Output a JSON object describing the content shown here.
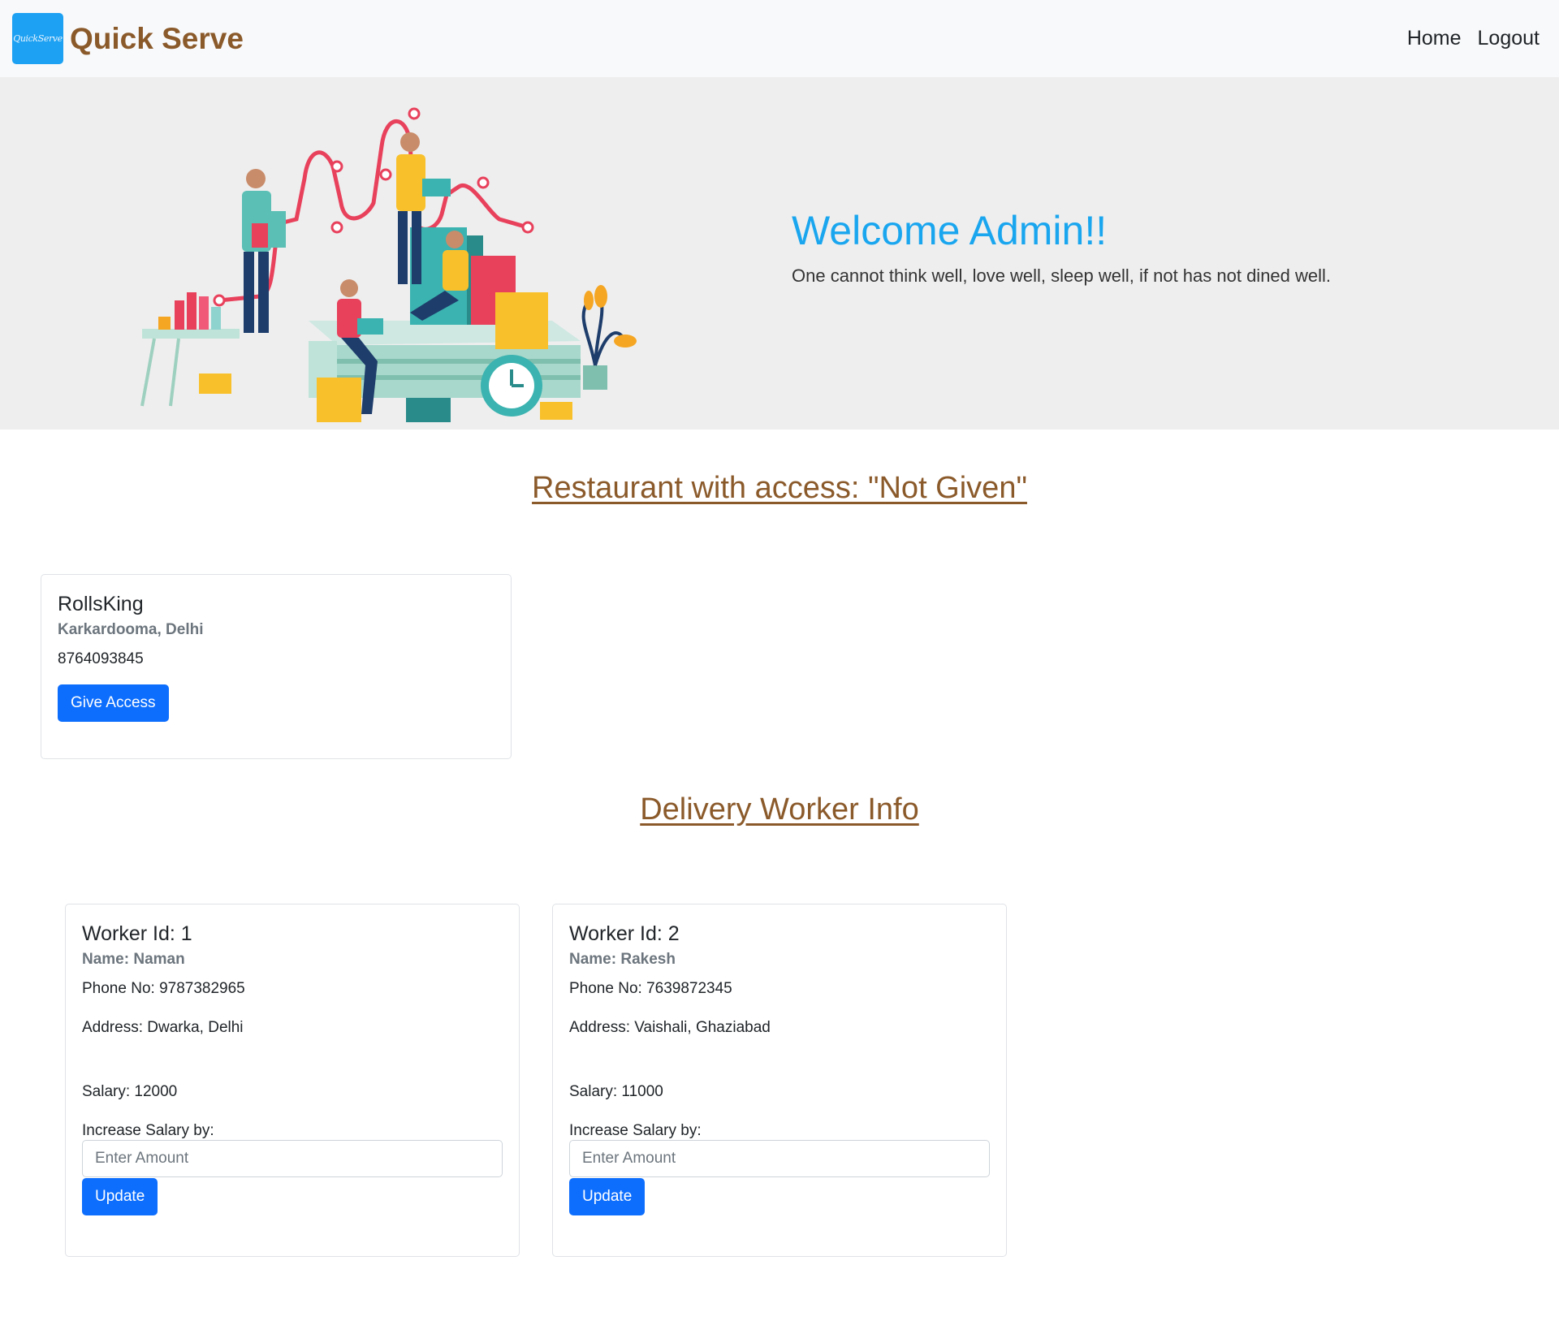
{
  "brand": {
    "logo_text": "QuickServe",
    "name": "Quick Serve"
  },
  "nav": {
    "home": "Home",
    "logout": "Logout"
  },
  "hero": {
    "title": "Welcome Admin!!",
    "quote": "One cannot think well, love well, sleep well, if not has not dined well."
  },
  "restaurants": {
    "heading": "Restaurant with access: \"Not Given\"",
    "items": [
      {
        "name": "RollsKing",
        "location": "Karkardooma, Delhi",
        "phone": "8764093845",
        "button": "Give Access"
      }
    ]
  },
  "workers": {
    "heading": "Delivery Worker Info",
    "items": [
      {
        "title": "Worker Id: 1",
        "name": "Name: Naman",
        "phone": "Phone No: 9787382965",
        "address": "Address: Dwarka, Delhi",
        "salary": "Salary: 12000",
        "increase_label": "Increase Salary by:",
        "placeholder": "Enter Amount",
        "button": "Update"
      },
      {
        "title": "Worker Id: 2",
        "name": "Name: Rakesh",
        "phone": "Phone No: 7639872345",
        "address": "Address: Vaishali, Ghaziabad",
        "salary": "Salary: 11000",
        "increase_label": "Increase Salary by:",
        "placeholder": "Enter Amount",
        "button": "Update"
      }
    ]
  },
  "colors": {
    "brand_brown": "#8b5a2b",
    "hero_title_blue": "#1aa6ef",
    "button_blue": "#0d6efd",
    "navbar_bg": "#f8f9fa",
    "hero_bg": "#eeeeee",
    "logo_blue": "#1da1f2"
  }
}
